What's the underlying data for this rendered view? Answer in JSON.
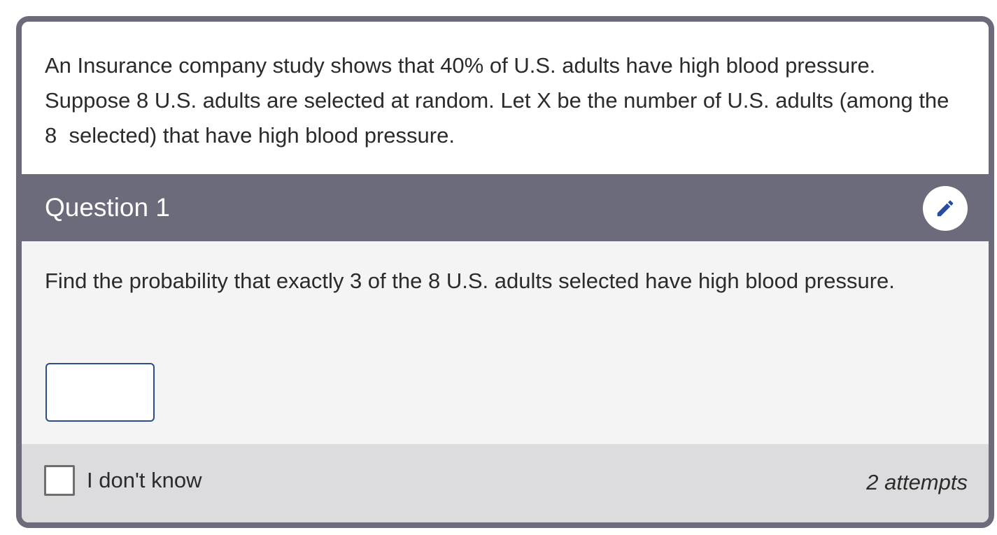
{
  "stem": {
    "text": "An Insurance company study shows that 40% of U.S. adults have high blood pressure. Suppose 8 U.S. adults are selected at random. Let X be the number of U.S. adults (among the 8  selected) that have high blood pressure."
  },
  "question": {
    "title": "Question 1",
    "edit_icon": "pencil-icon",
    "prompt": "Find the probability that exactly 3 of the 8 U.S. adults selected have high blood pressure.",
    "answer_value": ""
  },
  "footer": {
    "idk_label": "I don't know",
    "idk_checked": false,
    "attempts": "2 attempts"
  },
  "colors": {
    "header": "#6c6b7b",
    "body": "#f4f4f4",
    "footer": "#dcdcde",
    "accent": "#2a4d8f"
  }
}
